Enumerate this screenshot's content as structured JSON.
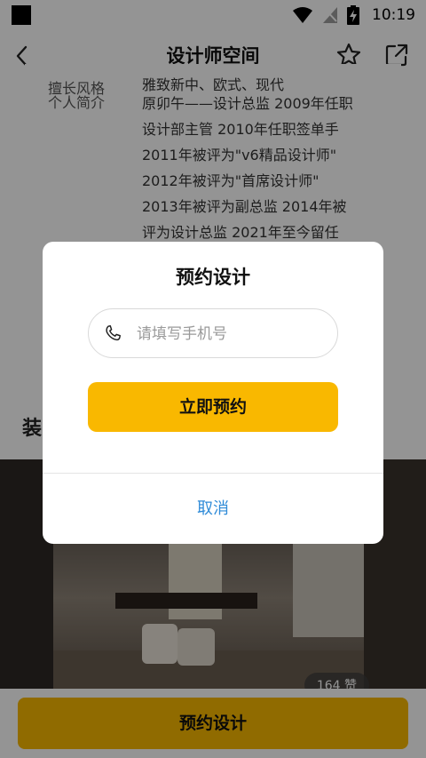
{
  "status_bar": {
    "time": "10:19"
  },
  "nav": {
    "title": "设计师空间"
  },
  "profile": {
    "style_label": "擅长风格",
    "style_value": "雅致新中、欧式、现代",
    "intro_label": "个人简介",
    "intro_lines": [
      "原卯午——设计总监 2009年任职",
      "设计部主管 2010年任职签单手",
      "2011年被评为\"v6精品设计师\"",
      "2012年被评为\"首席设计师\"",
      "2013年被评为副总监 2014年被",
      "评为设计总监 2021年至今留任"
    ]
  },
  "section": {
    "title": "装"
  },
  "case_photo": {
    "likes": "164 赞"
  },
  "bottom": {
    "button_label": "预约设计"
  },
  "dialog": {
    "title": "预约设计",
    "phone_placeholder": "请填写手机号",
    "confirm_label": "立即预约",
    "cancel_label": "取消"
  },
  "colors": {
    "accent": "#f9b800",
    "link": "#2f8bd8"
  }
}
